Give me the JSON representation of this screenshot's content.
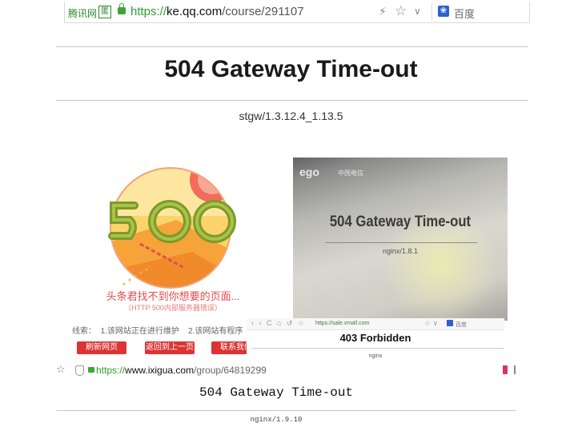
{
  "top_browser": {
    "brand": "腾讯网",
    "brand_box": "匿",
    "url_scheme": "https://",
    "url_host": "ke.qq.com",
    "url_path": "/course/291107",
    "search_engine": "百度",
    "icons": [
      "lightning-icon",
      "star-icon",
      "chevron-down-icon",
      "baidu-paw-icon"
    ]
  },
  "main": {
    "title": "504 Gateway Time-out",
    "server": "stgw/1.3.12.4_1.13.5"
  },
  "panel_500": {
    "big_number": "500",
    "caption": "头条君找不到你想要的页面...",
    "caption_sub": "（HTTP 500内部服务器错误）",
    "clue_label": "线索：",
    "clue_1": "1.该网站正在进行维护",
    "clue_2": "2.该网站有程序",
    "buttons": [
      "刷新网页",
      "返回到上一页",
      "联系我们"
    ],
    "accent": "#dd3333"
  },
  "photo_panel": {
    "logo": "ego",
    "logo_sub": "中国电信",
    "title": "504 Gateway Time-out",
    "server": "nginx/1.8.1"
  },
  "window_403": {
    "nav": "‹ › C ⌂ ↺ ☆",
    "url": "https://sale.vmall.com",
    "right_icons": "☆ ∨",
    "search": "百度",
    "title": "403 Forbidden",
    "server": "nginx"
  },
  "bottom_browser": {
    "url_scheme": "https://",
    "url_host": "www.ixigua.com",
    "url_path": "/group/64819299"
  },
  "bottom_page": {
    "title": "504 Gateway Time-out",
    "server": "nginx/1.9.10"
  }
}
